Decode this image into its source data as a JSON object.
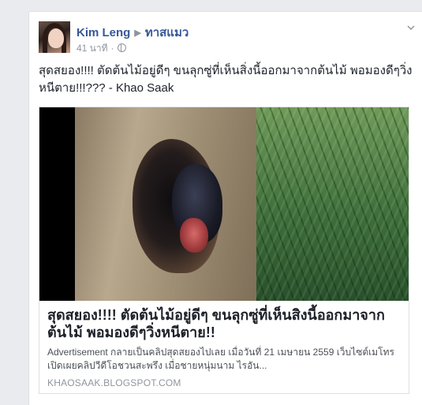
{
  "post": {
    "author": "Kim Leng",
    "group": "ทาสแมว",
    "timestamp": "41 นาที",
    "separator": "·",
    "message": "สุดสยอง!!!! ตัดต้นไม้อยู่ดีๆ ขนลุกซู่ที่เห็นสิ่งนี้ออกมาจากต้นไม้ พอมองดีๆวิ่งหนีตาย!!!??? - Khao Saak"
  },
  "link_card": {
    "title": "สุดสยอง!!!! ตัดต้นไม้อยู่ดีๆ ขนลุกซู่ที่เห็นสิงนี้ออกมาจากต้นไม้ พอมองดีๆวิ่งหนีตาย!!",
    "description": "Advertisement กลายเป็นคลิปสุดสยองไปเลย เมื่อวันที่ 21 เมษายน 2559 เว็บไซต์เมโทร เปิดเผยคลิปวีดีโอชวนสะพรึง เมื่อชายหนุ่มนาม ไรอัน...",
    "domain": "KHAOSAAK.BLOGSPOT.COM"
  },
  "icons": {
    "group_arrow": "▶",
    "menu": "chevron-down-icon",
    "privacy": "globe-icon"
  },
  "colors": {
    "link_blue": "#365899",
    "meta_gray": "#90949c",
    "text": "#1d2129",
    "background": "#e9ebee"
  }
}
